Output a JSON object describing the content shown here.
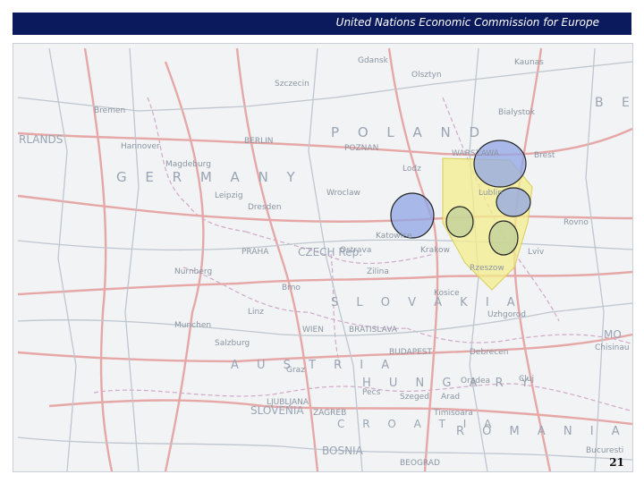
{
  "header": {
    "title": "United Nations Economic Commission for Europe"
  },
  "page_number": "21",
  "colors": {
    "header_bg": "#0a1a5c",
    "corridor_fill": "#f3ee8c",
    "circle_fill": "#8fa6e6",
    "road": "#e2a9a9"
  },
  "country_labels": {
    "poland": "P O L A N D",
    "germany": "G E R M A N Y",
    "czech": "CZECH Rep.",
    "slovakia": "S L O V A K I A",
    "austria": "A U S T R I A",
    "hungary": "H U N G A R Y",
    "slovenia": "SLOVENIA",
    "croatia": "C R O A T I A",
    "bosnia": "BOSNIA",
    "romania": "R O M A N I A",
    "netherlands": "RLANDS",
    "belarus": "B E",
    "moldova": "MO"
  },
  "cities": {
    "berlin": "BERLIN",
    "warszawa": "WARSZAWA",
    "praha": "PRAHA",
    "wien": "WIEN",
    "bratislava": "BRATISLAVA",
    "budapest": "BUDAPEST",
    "hannover": "Hannover",
    "magdeburg": "Magdeburg",
    "leipzig": "Leipzig",
    "dresden": "Dresden",
    "wroclaw": "Wroclaw",
    "poznan": "POZNAN",
    "lodz": "Lodz",
    "katowice": "Katowice",
    "krakow": "Krakow",
    "lublin": "Lublin",
    "rzeszow": "Rzeszow",
    "kosice": "Kosice",
    "zagreb": "ZAGREB",
    "ljubljana": "LJUBLJANA",
    "beograd": "BEOGRAD",
    "timisoara": "Timisoara",
    "cluj": "Cluj",
    "debrecen": "Debrecen",
    "lviv": "Lviv",
    "rovno": "Rovno",
    "brest": "Brest",
    "bialystok": "Bialystok",
    "kaunas": "Kaunas",
    "nurnberg": "Nurnberg",
    "munchen": "Munchen",
    "salzburg": "Salzburg",
    "graz": "Graz",
    "linz": "Linz",
    "bremen": "Bremen",
    "szczecin": "Szczecin",
    "gdansk": "Gdansk",
    "olsztyn": "Olsztyn",
    "ostrava": "Ostrava",
    "brno": "Brno",
    "zilina": "Zilina",
    "uzhgorod": "Uzhgorod",
    "oradea": "Oradea",
    "arad": "Arad",
    "szeged": "Szeged",
    "pecs": "Pecs",
    "bucuresti": "Bucuresti",
    "chisinau": "Chisinau"
  }
}
